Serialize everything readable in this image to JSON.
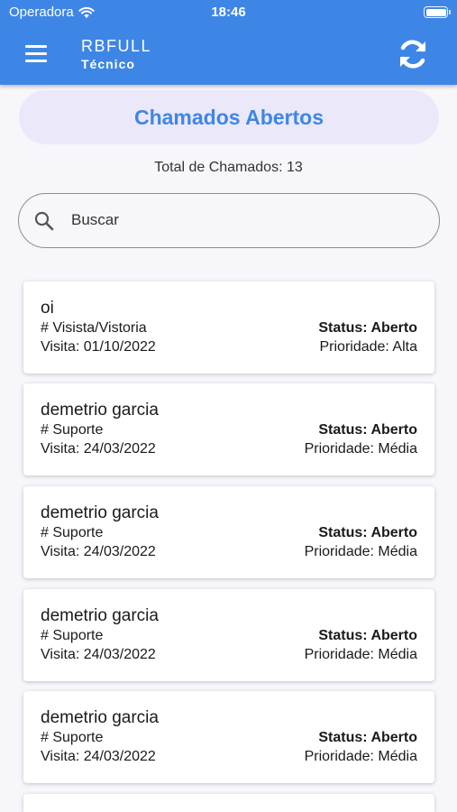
{
  "status_bar": {
    "carrier": "Operadora",
    "time": "18:46",
    "wifi_icon": "wifi-icon",
    "battery_icon": "battery-icon"
  },
  "app_bar": {
    "title": "RBFULL",
    "subtitle": "Técnico",
    "menu_icon": "menu-icon",
    "refresh_icon": "refresh-icon",
    "color": "#3e86e6"
  },
  "header": {
    "title": "Chamados Abertos",
    "total_label": "Total de Chamados: 13"
  },
  "search": {
    "placeholder": "Buscar",
    "icon": "search-icon"
  },
  "tickets": [
    {
      "name": "oi",
      "type": "# Visista/Vistoria",
      "visit": "Visita: 01/10/2022",
      "status": "Status: Aberto",
      "priority": "Prioridade: Alta"
    },
    {
      "name": "demetrio garcia",
      "type": "# Suporte",
      "visit": "Visita: 24/03/2022",
      "status": "Status: Aberto",
      "priority": "Prioridade: Média"
    },
    {
      "name": "demetrio garcia",
      "type": "# Suporte",
      "visit": "Visita: 24/03/2022",
      "status": "Status: Aberto",
      "priority": "Prioridade: Média"
    },
    {
      "name": "demetrio garcia",
      "type": "# Suporte",
      "visit": "Visita: 24/03/2022",
      "status": "Status: Aberto",
      "priority": "Prioridade: Média"
    },
    {
      "name": "demetrio garcia",
      "type": "# Suporte",
      "visit": "Visita: 24/03/2022",
      "status": "Status: Aberto",
      "priority": "Prioridade: Média"
    }
  ]
}
